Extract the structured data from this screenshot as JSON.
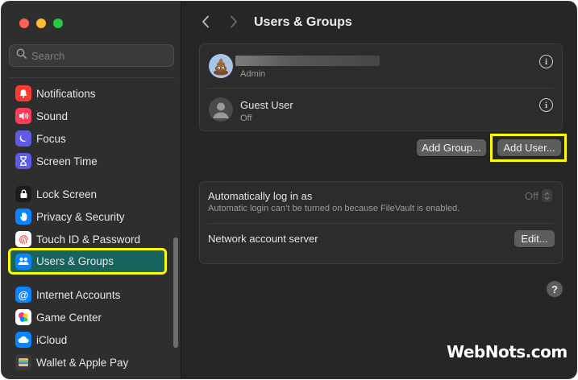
{
  "window": {
    "title": "Users & Groups"
  },
  "search": {
    "placeholder": "Search"
  },
  "sidebar": {
    "items": [
      {
        "label": "Notifications",
        "color": "#ff3b30",
        "icon": "bell-icon"
      },
      {
        "label": "Sound",
        "color": "#ff3b5c",
        "icon": "speaker-icon"
      },
      {
        "label": "Focus",
        "color": "#5e5ce6",
        "icon": "moon-icon"
      },
      {
        "label": "Screen Time",
        "color": "#5e5ce6",
        "icon": "hourglass-icon"
      },
      {
        "label": "Lock Screen",
        "color": "#1c1c1e",
        "icon": "lock-icon"
      },
      {
        "label": "Privacy & Security",
        "color": "#0a84ff",
        "icon": "hand-icon"
      },
      {
        "label": "Touch ID & Password",
        "color": "#ff453a",
        "icon": "fingerprint-icon"
      },
      {
        "label": "Users & Groups",
        "color": "#0a84ff",
        "icon": "users-icon"
      },
      {
        "label": "Internet Accounts",
        "color": "#0a84ff",
        "icon": "at-icon"
      },
      {
        "label": "Game Center",
        "color": "#ffffff",
        "icon": "game-center-icon"
      },
      {
        "label": "iCloud",
        "color": "#0a84ff",
        "icon": "cloud-icon"
      },
      {
        "label": "Wallet & Apple Pay",
        "color": "#3a3a3c",
        "icon": "wallet-icon"
      }
    ]
  },
  "users": [
    {
      "role": "Admin",
      "avatar": "emoji-avatar"
    },
    {
      "name": "Guest User",
      "role": "Off",
      "avatar": "guest-avatar"
    }
  ],
  "actions": {
    "add_group": "Add Group...",
    "add_user": "Add User..."
  },
  "login": {
    "auto_login_label": "Automatically log in as",
    "auto_login_hint": "Automatic login can’t be turned on because FileVault is enabled.",
    "auto_login_value": "Off",
    "network_server_label": "Network account server",
    "edit_button": "Edit..."
  },
  "help": {
    "label": "?"
  },
  "watermark": "WebNots.com"
}
